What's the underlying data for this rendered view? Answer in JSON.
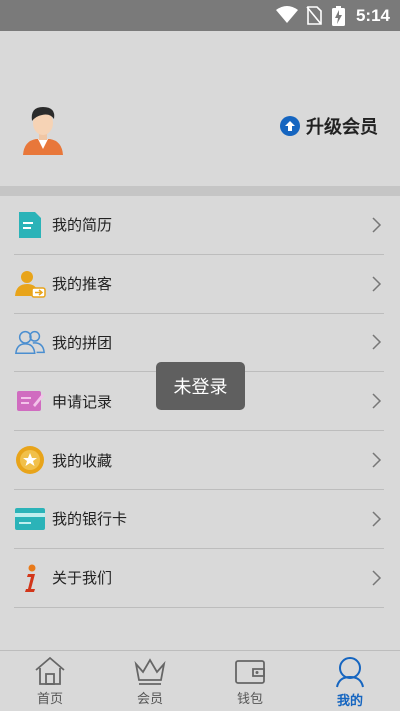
{
  "status_bar": {
    "time": "5:14",
    "icons": [
      "wifi-icon",
      "no-sim-icon",
      "battery-charging-icon"
    ]
  },
  "profile": {
    "upgrade_label": "升级会员",
    "upgrade_icon": "arrow-up-circle-icon"
  },
  "menu": {
    "items": [
      {
        "label": "我的简历",
        "icon": "resume-icon"
      },
      {
        "label": "我的推客",
        "icon": "referral-user-icon"
      },
      {
        "label": "我的拼团",
        "icon": "group-users-icon"
      },
      {
        "label": "申请记录",
        "icon": "application-record-icon"
      },
      {
        "label": "我的收藏",
        "icon": "star-favorite-icon"
      },
      {
        "label": "我的银行卡",
        "icon": "bank-card-icon"
      },
      {
        "label": "关于我们",
        "icon": "info-icon"
      }
    ]
  },
  "toast": {
    "text": "未登录"
  },
  "tabbar": {
    "tabs": [
      {
        "label": "首页",
        "icon": "home-icon"
      },
      {
        "label": "会员",
        "icon": "crown-icon"
      },
      {
        "label": "钱包",
        "icon": "wallet-icon"
      },
      {
        "label": "我的",
        "icon": "user-icon",
        "active": true
      }
    ]
  },
  "colors": {
    "accent": "#1565c0",
    "background": "#d9d9d9",
    "status_bar": "#7a7a7a",
    "toast": "#5f5f5f"
  }
}
